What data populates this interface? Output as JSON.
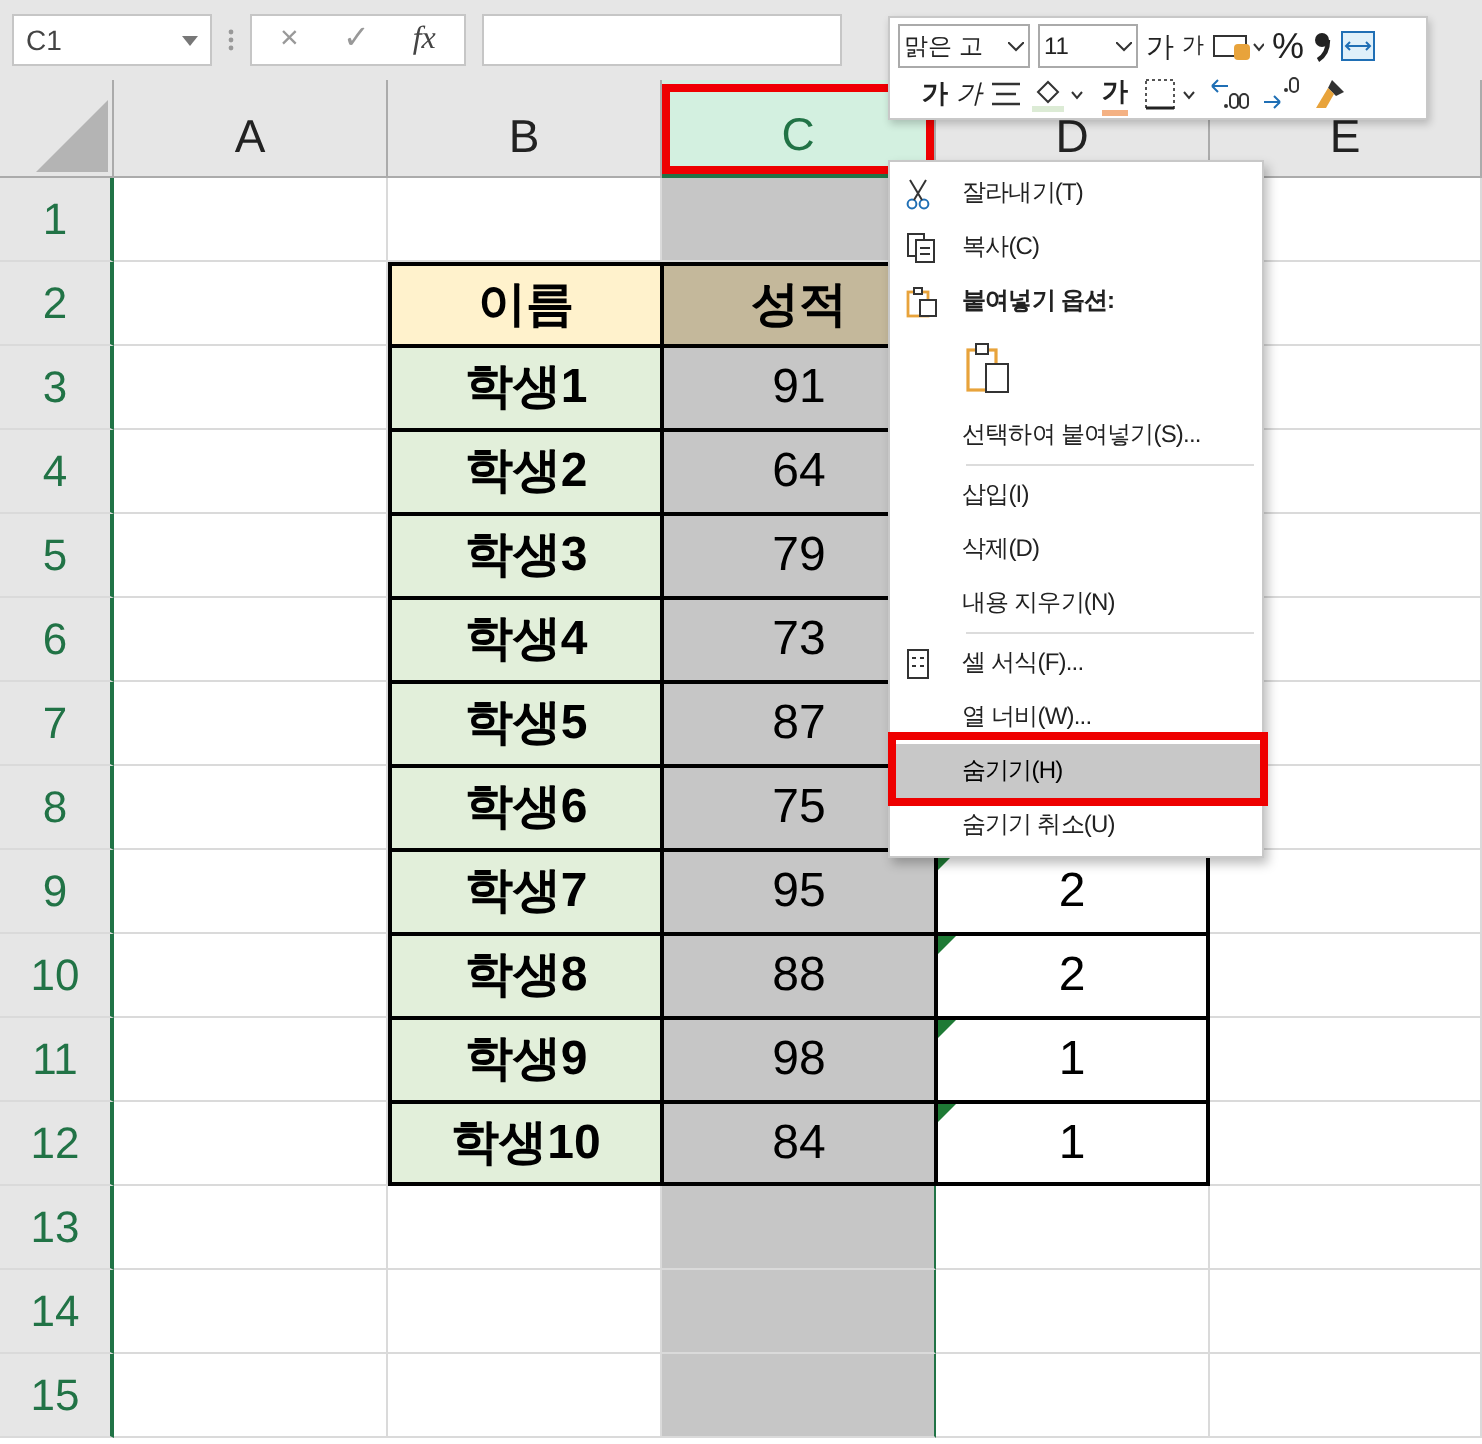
{
  "formula_bar": {
    "name_box": "C1",
    "buttons": [
      "×",
      "✓",
      "fx"
    ]
  },
  "columns": [
    {
      "label": "A",
      "selected": false,
      "highlight": false
    },
    {
      "label": "B",
      "selected": false,
      "highlight": false
    },
    {
      "label": "C",
      "selected": true,
      "highlight": true
    },
    {
      "label": "D",
      "selected": false,
      "highlight": false
    },
    {
      "label": "E",
      "selected": false,
      "highlight": false
    }
  ],
  "rows": [
    {
      "number": "1"
    },
    {
      "number": "2",
      "name": "이름",
      "score": "성적",
      "header": true
    },
    {
      "number": "3",
      "name": "학생1",
      "score": "91"
    },
    {
      "number": "4",
      "name": "학생2",
      "score": "64"
    },
    {
      "number": "5",
      "name": "학생3",
      "score": "79"
    },
    {
      "number": "6",
      "name": "학생4",
      "score": "73"
    },
    {
      "number": "7",
      "name": "학생5",
      "score": "87"
    },
    {
      "number": "8",
      "name": "학생6",
      "score": "75"
    },
    {
      "number": "9",
      "name": "학생7",
      "score": "95",
      "rank": "2",
      "error_flag": true
    },
    {
      "number": "10",
      "name": "학생8",
      "score": "88",
      "rank": "2",
      "error_flag": true
    },
    {
      "number": "11",
      "name": "학생9",
      "score": "98",
      "rank": "1",
      "error_flag": true
    },
    {
      "number": "12",
      "name": "학생10",
      "score": "84",
      "rank": "1",
      "error_flag": true
    },
    {
      "number": "13"
    },
    {
      "number": "14"
    },
    {
      "number": "15"
    }
  ],
  "mini_toolbar": {
    "font_group": [
      {
        "kind": "font-field",
        "value": "맑은 고"
      },
      {
        "kind": "size-field",
        "value": "11"
      },
      {
        "kind": "grow",
        "label": "가"
      },
      {
        "kind": "shrink",
        "label": "가"
      },
      {
        "kind": "styles"
      },
      {
        "kind": "percent",
        "label": "%"
      },
      {
        "kind": "comma"
      },
      {
        "kind": "wrap"
      }
    ],
    "format_group": [
      {
        "kind": "bold",
        "label": "가"
      },
      {
        "kind": "italic",
        "label": "가"
      },
      {
        "kind": "align"
      },
      {
        "kind": "fill"
      },
      {
        "kind": "font-color",
        "label": "가"
      },
      {
        "kind": "borders"
      },
      {
        "kind": "inc-decimal"
      },
      {
        "kind": "dec-decimal"
      },
      {
        "kind": "painter"
      }
    ]
  },
  "context_menu": [
    {
      "kind": "cut",
      "label": "잘라내기(T)",
      "selected": false,
      "highlight": false
    },
    {
      "kind": "copy",
      "label": "복사(C)",
      "selected": false,
      "highlight": false
    },
    {
      "kind": "paste-heading",
      "label": "붙여넣기 옵션:",
      "selected": false,
      "highlight": false
    },
    {
      "kind": "paste-option",
      "selected": false,
      "highlight": false
    },
    {
      "kind": "plain",
      "label": "선택하여 붙여넣기(S)...",
      "selected": false,
      "highlight": false
    },
    {
      "kind": "divider"
    },
    {
      "kind": "plain",
      "label": "삽입(I)",
      "selected": false,
      "highlight": false
    },
    {
      "kind": "plain",
      "label": "삭제(D)",
      "selected": false,
      "highlight": false
    },
    {
      "kind": "plain",
      "label": "내용 지우기(N)",
      "selected": false,
      "highlight": false
    },
    {
      "kind": "divider"
    },
    {
      "kind": "format",
      "label": "셀 서식(F)...",
      "selected": false,
      "highlight": false
    },
    {
      "kind": "plain",
      "label": "열 너비(W)...",
      "selected": false,
      "highlight": false
    },
    {
      "kind": "plain",
      "label": "숨기기(H)",
      "selected": true,
      "highlight": true
    },
    {
      "kind": "plain",
      "label": "숨기기 취소(U)",
      "selected": false,
      "highlight": false
    }
  ]
}
